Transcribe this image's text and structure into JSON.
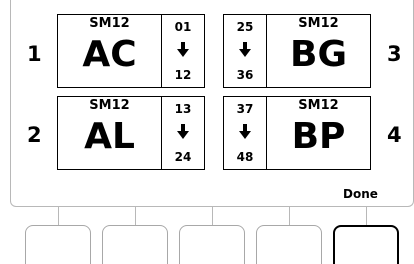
{
  "slots": [
    {
      "number": "1",
      "model": "SM12",
      "code": "AC",
      "start": "01",
      "end": "12",
      "icon": "arrow-down-icon"
    },
    {
      "number": "2",
      "model": "SM12",
      "code": "AL",
      "start": "13",
      "end": "24",
      "icon": "arrow-down-icon"
    },
    {
      "number": "3",
      "model": "SM12",
      "code": "BG",
      "start": "25",
      "end": "36",
      "icon": "arrow-down-icon"
    },
    {
      "number": "4",
      "model": "SM12",
      "code": "BP",
      "start": "37",
      "end": "48",
      "icon": "arrow-down-icon"
    }
  ],
  "softkeys": {
    "done_label": "Done"
  },
  "colors": {
    "border": "#000000",
    "bezel": "#b8b8b8"
  }
}
